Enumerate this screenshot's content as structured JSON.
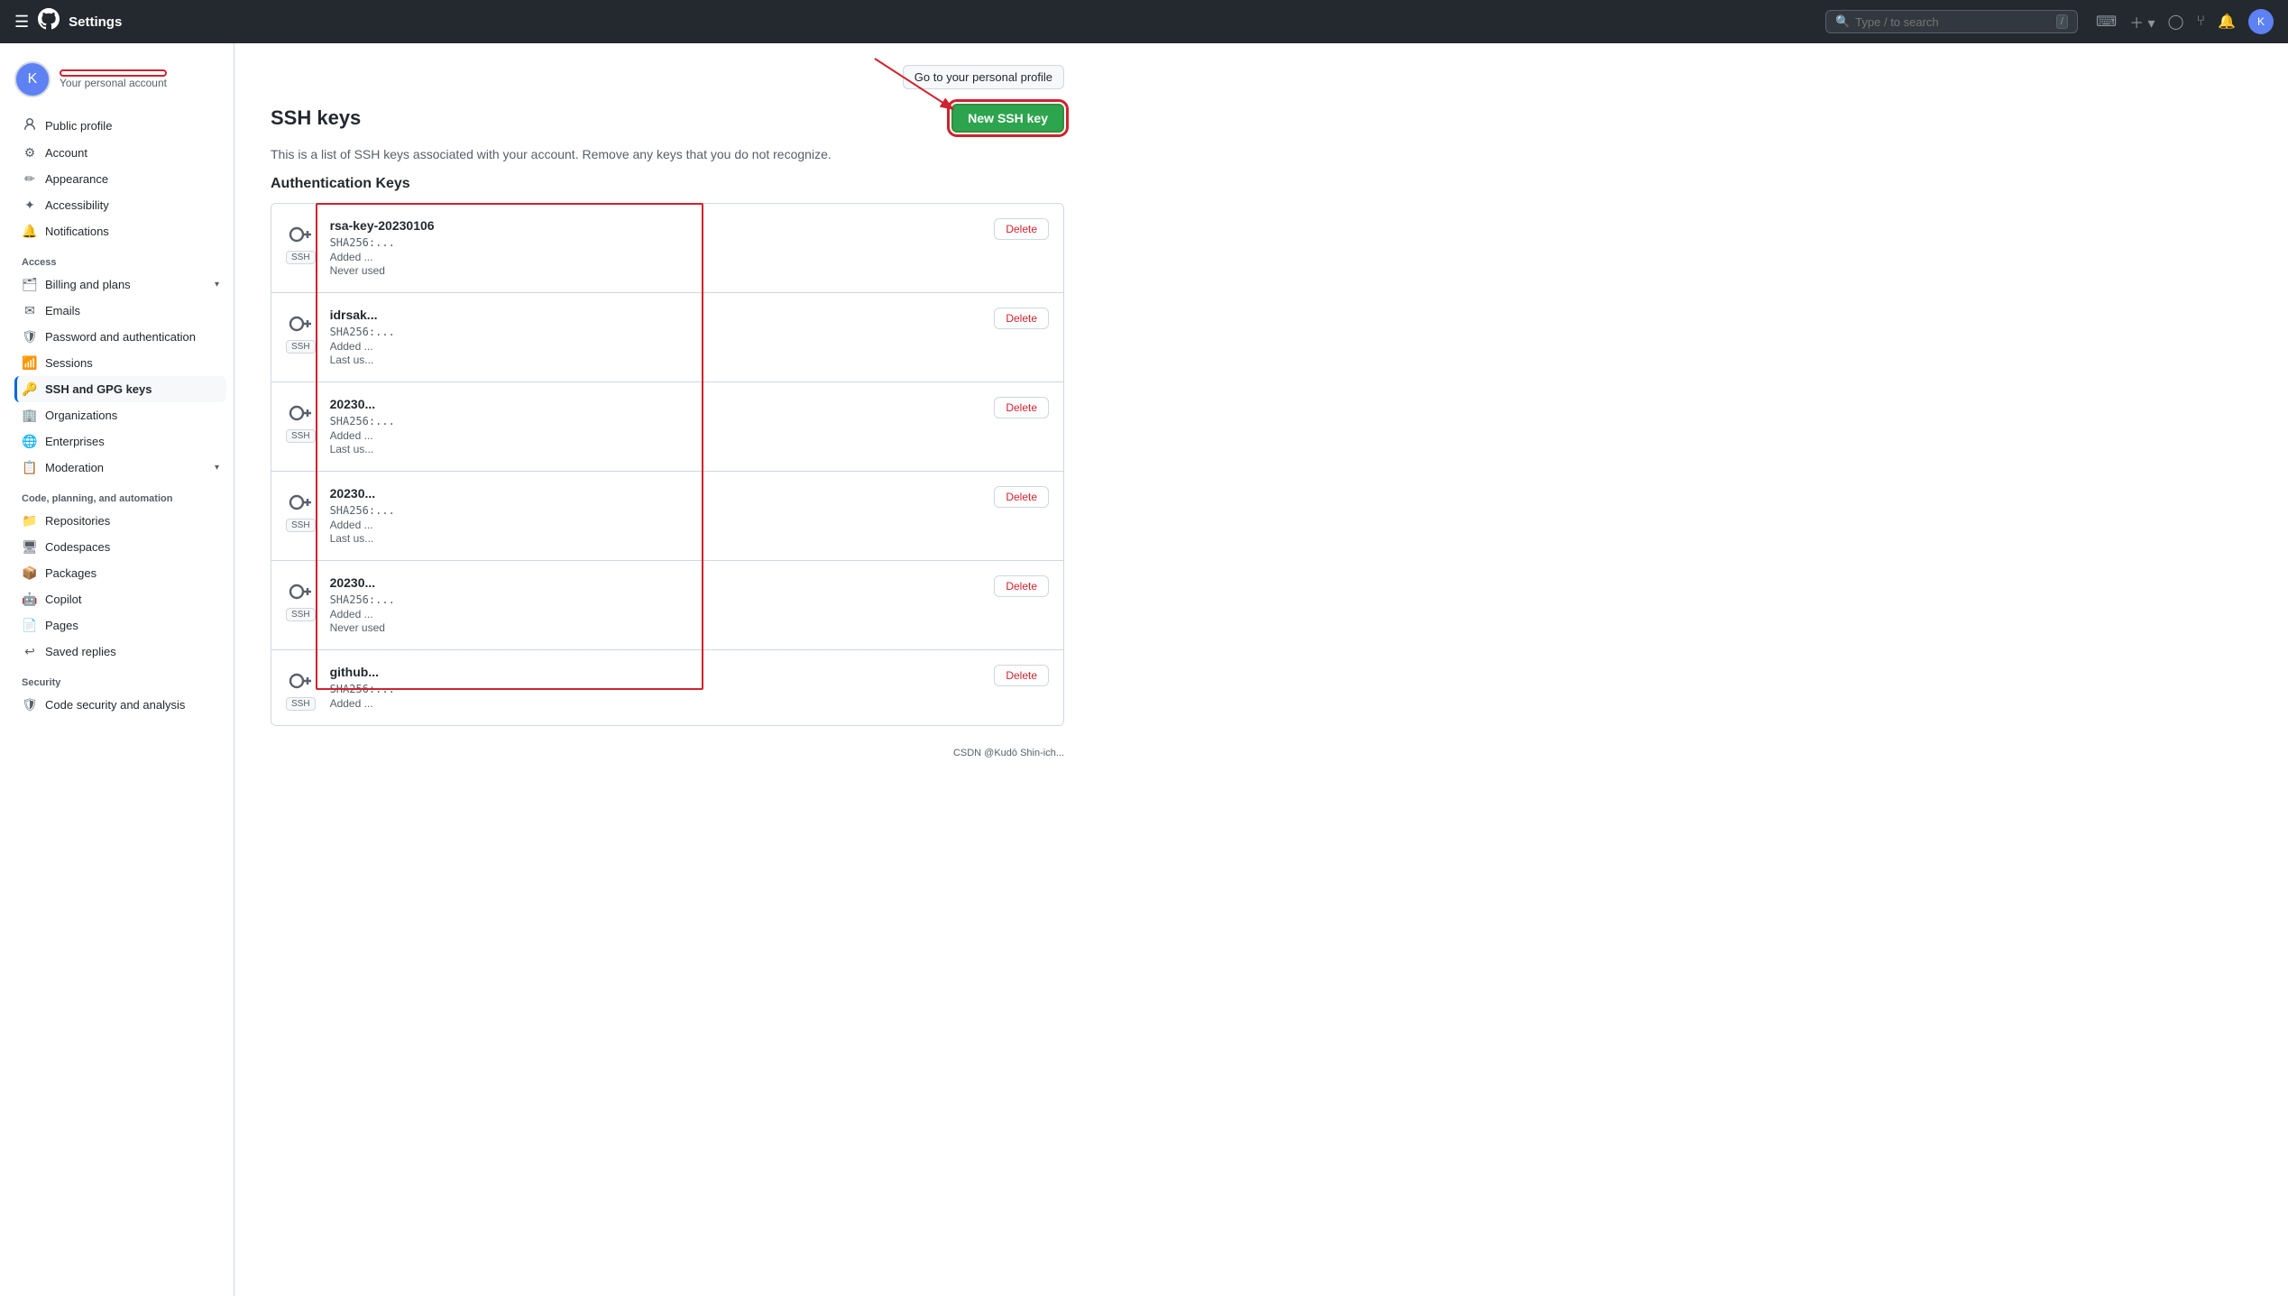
{
  "topnav": {
    "title": "Settings",
    "search_placeholder": "Type / to search",
    "slash_label": "/"
  },
  "sidebar": {
    "user": {
      "personal_account_label": "Your personal account"
    },
    "nav_items": [
      {
        "id": "public-profile",
        "label": "Public profile",
        "icon": "👤"
      },
      {
        "id": "account",
        "label": "Account",
        "icon": "⚙"
      },
      {
        "id": "appearance",
        "label": "Appearance",
        "icon": "✏"
      },
      {
        "id": "accessibility",
        "label": "Accessibility",
        "icon": "✦"
      },
      {
        "id": "notifications",
        "label": "Notifications",
        "icon": "🔔"
      }
    ],
    "access_label": "Access",
    "access_items": [
      {
        "id": "billing",
        "label": "Billing and plans",
        "icon": "🗂",
        "expandable": true
      },
      {
        "id": "emails",
        "label": "Emails",
        "icon": "✉"
      },
      {
        "id": "password",
        "label": "Password and authentication",
        "icon": "🛡"
      },
      {
        "id": "sessions",
        "label": "Sessions",
        "icon": "📶"
      },
      {
        "id": "ssh-gpg",
        "label": "SSH and GPG keys",
        "icon": "🔑",
        "active": true
      },
      {
        "id": "organizations",
        "label": "Organizations",
        "icon": "🏢"
      },
      {
        "id": "enterprises",
        "label": "Enterprises",
        "icon": "🌐"
      },
      {
        "id": "moderation",
        "label": "Moderation",
        "icon": "📋",
        "expandable": true
      }
    ],
    "code_label": "Code, planning, and automation",
    "code_items": [
      {
        "id": "repositories",
        "label": "Repositories",
        "icon": "📁"
      },
      {
        "id": "codespaces",
        "label": "Codespaces",
        "icon": "🖥"
      },
      {
        "id": "packages",
        "label": "Packages",
        "icon": "📦"
      },
      {
        "id": "copilot",
        "label": "Copilot",
        "icon": "🤖"
      },
      {
        "id": "pages",
        "label": "Pages",
        "icon": "📄"
      },
      {
        "id": "saved-replies",
        "label": "Saved replies",
        "icon": "↩"
      }
    ],
    "security_label": "Security",
    "security_items": [
      {
        "id": "code-security",
        "label": "Code security and analysis",
        "icon": "🛡"
      }
    ]
  },
  "main": {
    "go_to_profile_label": "Go to your personal profile",
    "page_title": "SSH keys",
    "new_ssh_key_label": "New SSH key",
    "description": "This is a list of SSH keys associated with your account. Remove any keys that you do not recognize.",
    "auth_keys_heading": "Authentication Keys",
    "delete_label": "Delete",
    "ssh_keys": [
      {
        "name": "rsa-key-20230106",
        "fingerprint": "SHA256:...",
        "added": "Added ...",
        "last_used": "Never used"
      },
      {
        "name": "idrsak...",
        "fingerprint": "SHA256:...",
        "added": "Added ...",
        "last_used": "Last us..."
      },
      {
        "name": "20230...",
        "fingerprint": "SHA256:...",
        "added": "Added ...",
        "last_used": "Last us..."
      },
      {
        "name": "20230...",
        "fingerprint": "SHA256:...",
        "added": "Added ...",
        "last_used": "Last us..."
      },
      {
        "name": "20230...",
        "fingerprint": "SHA256:...",
        "added": "Added ...",
        "last_used": "Never used"
      },
      {
        "name": "github...",
        "fingerprint": "SHA256:...",
        "added": "Added ...",
        "last_used": ""
      }
    ]
  }
}
